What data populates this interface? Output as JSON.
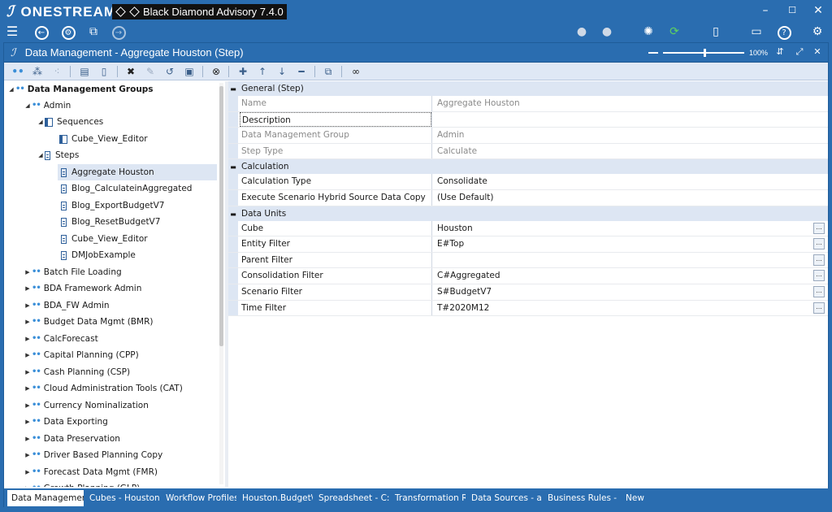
{
  "app": {
    "logo_text": "ONESTREAM",
    "window_title": "Black Diamond Advisory 7.4.0"
  },
  "window": {
    "title": "Data Management - Aggregate Houston (Step)",
    "zoom": "100%"
  },
  "tree": {
    "root": "Data Management Groups",
    "admin": "Admin",
    "sequences": "Sequences",
    "sequence_items": [
      "Cube_View_Editor"
    ],
    "steps": "Steps",
    "step_items": [
      "Aggregate Houston",
      "Blog_CalculateinAggregated",
      "Blog_ExportBudgetV7",
      "Blog_ResetBudgetV7",
      "Cube_View_Editor",
      "DMJobExample"
    ],
    "groups": [
      "Batch File Loading",
      "BDA Framework Admin",
      "BDA_FW Admin",
      "Budget Data Mgmt (BMR)",
      "CalcForecast",
      "Capital Planning (CPP)",
      "Cash Planning (CSP)",
      "Cloud Administration Tools (CAT)",
      "Currency Nominalization",
      "Data Exporting",
      "Data Preservation",
      "Driver Based Planning Copy",
      "Forecast Data Mgmt (FMR)",
      "Growth Planning (GLP)"
    ]
  },
  "props": {
    "general": {
      "label": "General (Step)",
      "name_label": "Name",
      "name_value": "Aggregate Houston",
      "description_label": "Description",
      "description_value": "",
      "group_label": "Data Management Group",
      "group_value": "Admin",
      "steptype_label": "Step Type",
      "steptype_value": "Calculate"
    },
    "calculation": {
      "label": "Calculation",
      "calctype_label": "Calculation Type",
      "calctype_value": "Consolidate",
      "hybrid_label": "Execute Scenario Hybrid Source Data Copy",
      "hybrid_value": "(Use Default)"
    },
    "data_units": {
      "label": "Data Units",
      "cube_label": "Cube",
      "cube_value": "Houston",
      "entity_label": "Entity Filter",
      "entity_value": "E#Top",
      "parent_label": "Parent Filter",
      "parent_value": "",
      "consol_label": "Consolidation Filter",
      "consol_value": "C#Aggregated",
      "scenario_label": "Scenario Filter",
      "scenario_value": "S#BudgetV7",
      "time_label": "Time Filter",
      "time_value": "T#2020M12"
    },
    "ellipsis": "..."
  },
  "tabs": [
    "Data Managemen",
    "Cubes - Houston",
    "Workflow Profiles",
    "Houston.Budget\\",
    "Spreadsheet - C:\\",
    "Transformation R",
    "Data Sources - as",
    "Business Rules - I",
    "New"
  ]
}
